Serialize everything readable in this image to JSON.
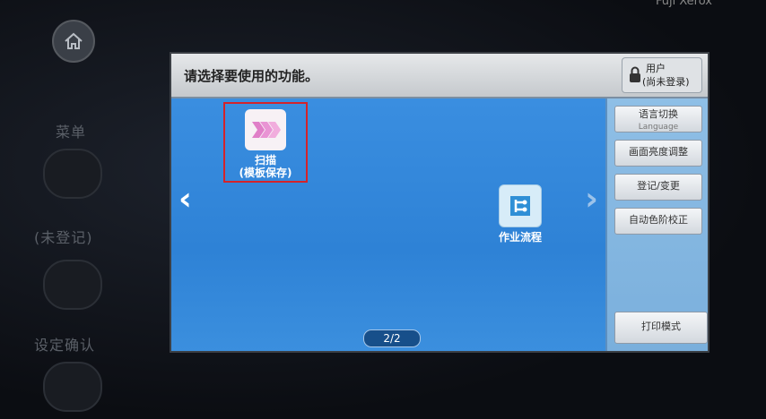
{
  "device": {
    "side_labels": [
      "菜单",
      "(未登记)",
      "设定确认"
    ],
    "top_text": "Fuji Xerox"
  },
  "header": {
    "title": "请选择要使用的功能。",
    "user_label": "用户",
    "user_status": "(尚未登录)"
  },
  "functions": [
    {
      "name": "scan",
      "label_line1": "扫描",
      "label_line2": "(模板保存)",
      "selected": true
    },
    {
      "name": "job-flow",
      "label_line1": "作业流程",
      "label_line2": ""
    }
  ],
  "pagination": {
    "current": "2/2"
  },
  "side_panel": {
    "language_label": "语言切换",
    "language_sub": "Language",
    "brightness_label": "画面亮度调整",
    "login_label": "登记/变更",
    "color_label": "自动色阶校正",
    "print_mode_label": "打印模式"
  },
  "colors": {
    "screen_blue": "#2a78c8",
    "selection_red": "#d4232a",
    "header_gray": "#d5d8db"
  }
}
